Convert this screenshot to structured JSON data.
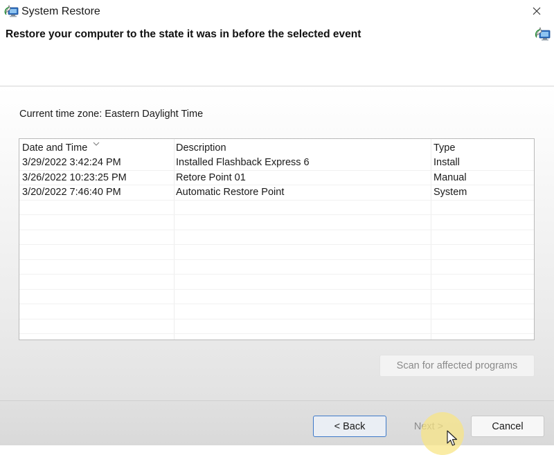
{
  "window": {
    "title": "System Restore",
    "icon": "system-restore-icon",
    "close_icon": "close-icon"
  },
  "header": {
    "title": "Restore your computer to the state it was in before the selected event",
    "icon": "system-restore-icon"
  },
  "timezone": {
    "label": "Current time zone: Eastern Daylight Time"
  },
  "restore_list": {
    "columns": [
      "Date and Time",
      "Description",
      "Type"
    ],
    "sort_indicator": "chevron-down-icon",
    "rows": [
      [
        "3/29/2022 3:42:24 PM",
        "Installed Flashback Express 6",
        "Install"
      ],
      [
        "3/26/2022 10:23:25 PM",
        "Retore Point 01",
        "Manual"
      ],
      [
        "3/20/2022 7:46:40 PM",
        "Automatic Restore Point",
        "System"
      ]
    ]
  },
  "buttons": {
    "scan": "Scan for affected programs",
    "back": "< Back",
    "next": "Next >",
    "cancel": "Cancel"
  },
  "colors": {
    "accent": "#3c78c8",
    "disabled_text": "#8a8a8a"
  }
}
